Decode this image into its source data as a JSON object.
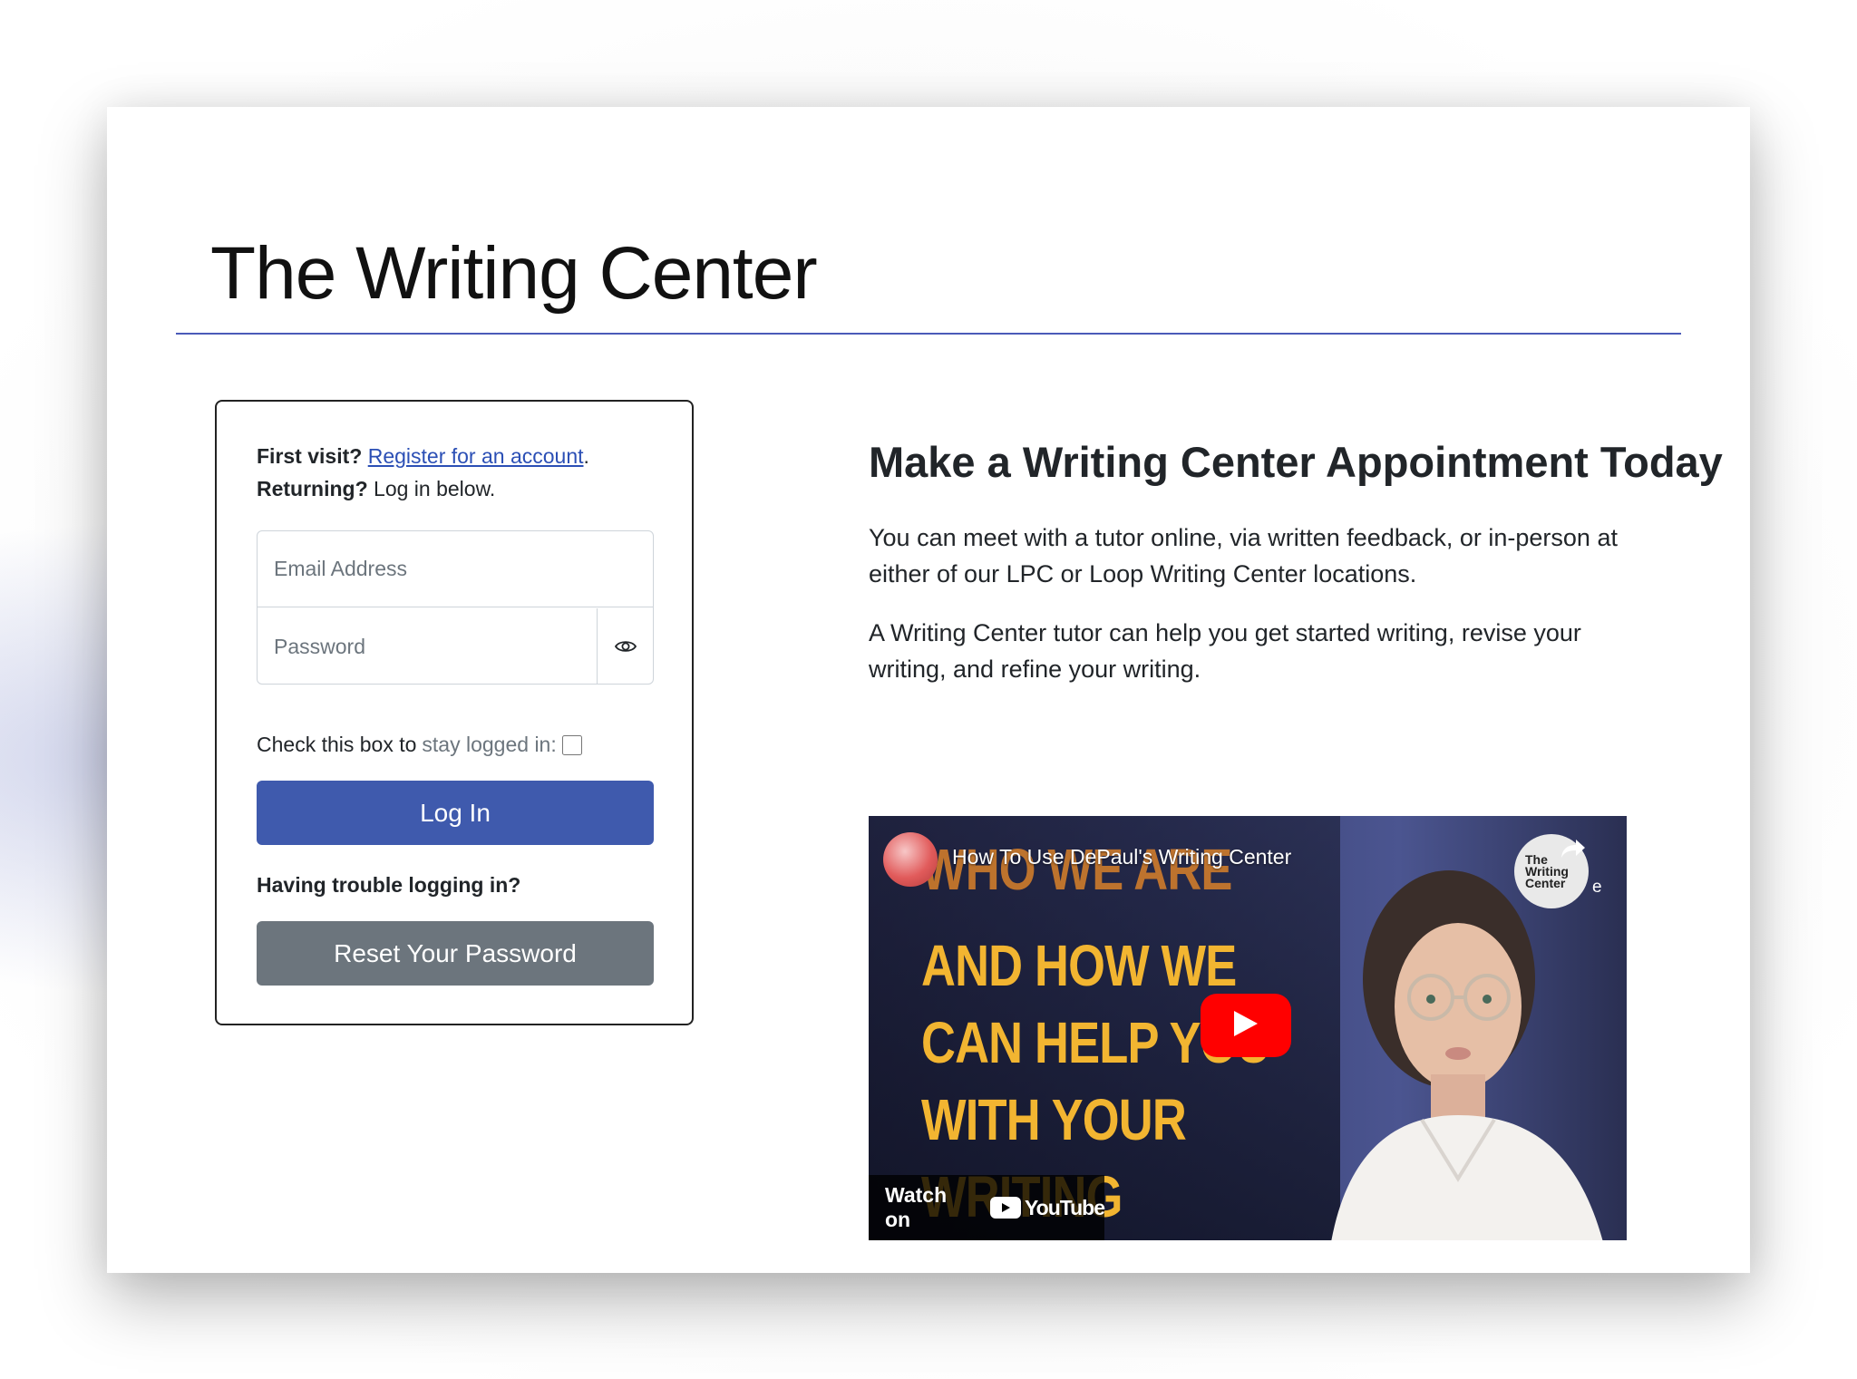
{
  "header": {
    "logo_text": "The Writing Center"
  },
  "login": {
    "first_visit_label": "First visit?",
    "register_link": "Register for an account",
    "register_suffix": ".",
    "returning_label": "Returning?",
    "returning_text": " Log in below.",
    "email_placeholder": "Email Address",
    "password_placeholder": "Password",
    "stay_prefix": "Check this box to",
    "stay_muted": "stay logged in:",
    "login_button": "Log In",
    "trouble_text": "Having trouble logging in?",
    "reset_button": "Reset Your Password"
  },
  "main": {
    "heading": "Make a Writing Center Appointment Today",
    "paragraph1": "You can meet with a tutor online, via written feedback, or in-person at either of our LPC or Loop Writing Center locations.",
    "paragraph2": "A Writing Center tutor can help you get started writing, revise your writing, and refine your writing."
  },
  "video": {
    "title": "How To Use DePaul's Writing Center",
    "overlay_lines": [
      "WHO WE ARE",
      "AND HOW WE",
      "CAN HELP YOU",
      "WITH YOUR",
      "WRITING"
    ],
    "channel_badge": "The Writing Center",
    "share_label": "e",
    "watch_on": "Watch on",
    "youtube_word": "YouTube",
    "colors": {
      "accent_text": "#f2b531",
      "play_button": "#ff0000"
    }
  },
  "colors": {
    "primary_button": "#3f5aad",
    "secondary_button": "#6c757d",
    "link": "#2b4fb5",
    "rule": "#4a5ab8"
  }
}
